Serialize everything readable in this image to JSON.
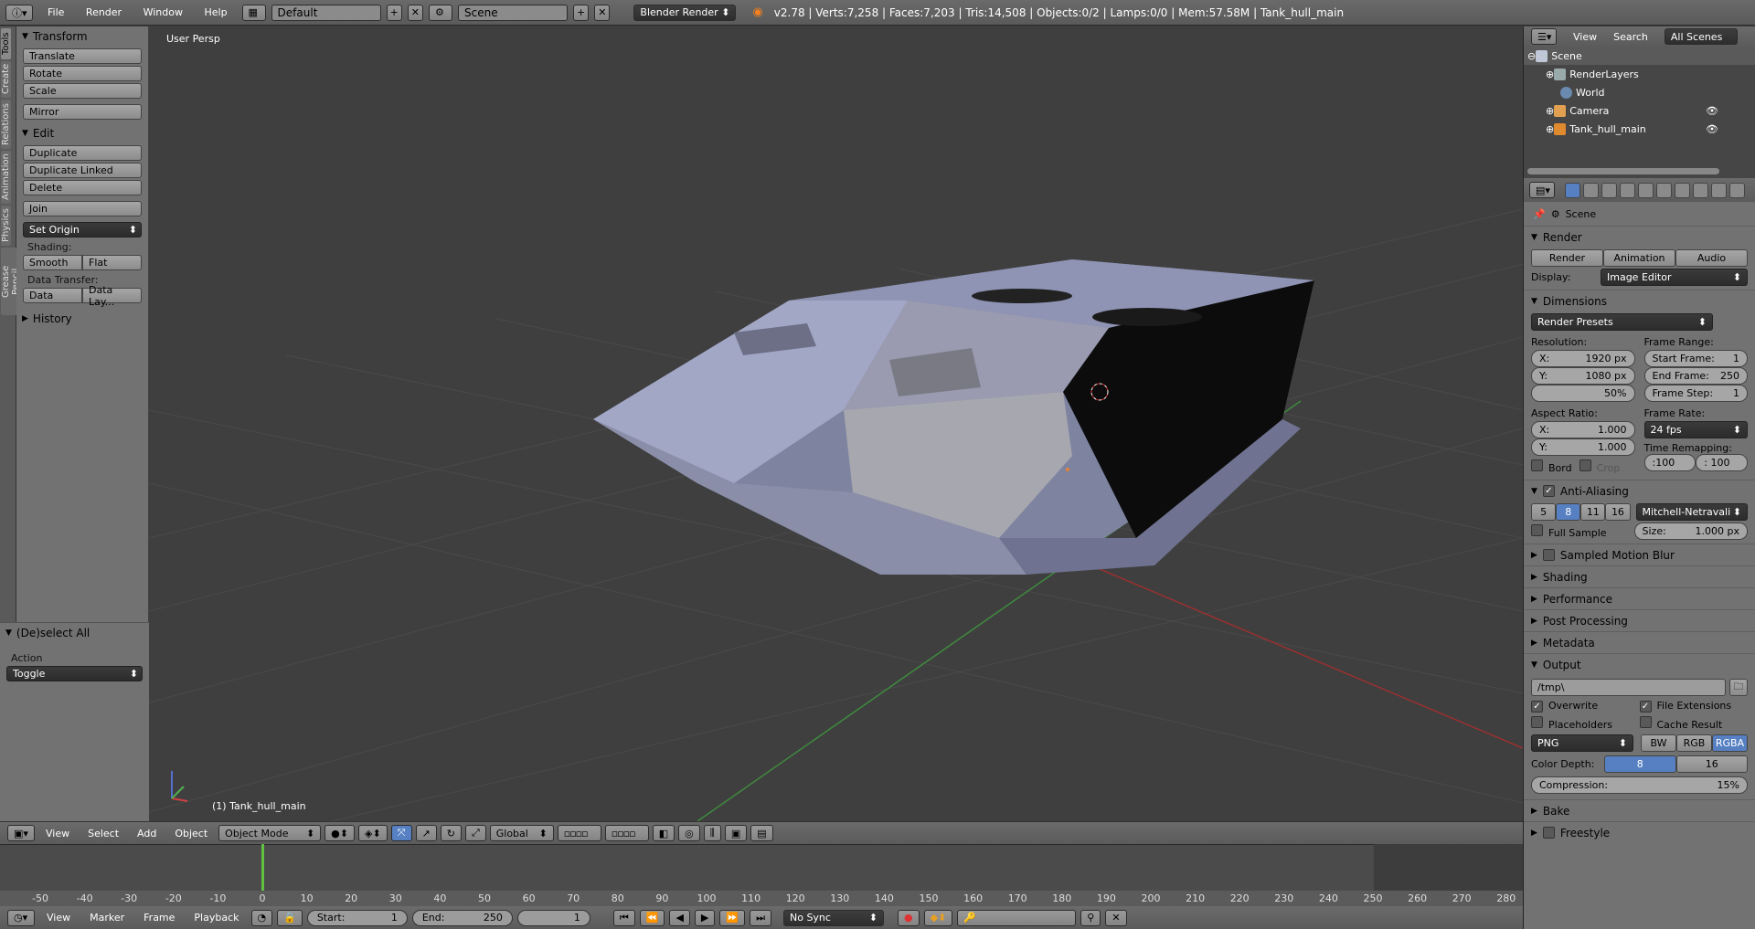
{
  "top_header": {
    "menus": [
      "File",
      "Render",
      "Window",
      "Help"
    ],
    "layout": "Default",
    "scene": "Scene",
    "engine": "Blender Render",
    "stats": "v2.78 | Verts:7,258 | Faces:7,203 | Tris:14,508 | Objects:0/2 | Lamps:0/0 | Mem:57.58M | Tank_hull_main"
  },
  "left_tabs": [
    "Tools",
    "Create",
    "Relations",
    "Animation",
    "Physics",
    "Grease Pencil"
  ],
  "tool_shelf": {
    "transform_title": "Transform",
    "translate": "Translate",
    "rotate": "Rotate",
    "scale": "Scale",
    "mirror": "Mirror",
    "edit_title": "Edit",
    "duplicate": "Duplicate",
    "duplicate_linked": "Duplicate Linked",
    "delete": "Delete",
    "join": "Join",
    "set_origin": "Set Origin",
    "shading_label": "Shading:",
    "smooth": "Smooth",
    "flat": "Flat",
    "data_transfer_label": "Data Transfer:",
    "data": "Data",
    "data_layers": "Data Lay...",
    "history_title": "History",
    "operator_title": "(De)select All",
    "action_label": "Action",
    "action_value": "Toggle"
  },
  "viewport": {
    "view_label": "User Persp",
    "object_label": "(1) Tank_hull_main"
  },
  "viewport_header": {
    "menus": [
      "View",
      "Select",
      "Add",
      "Object"
    ],
    "mode": "Object Mode",
    "orientation": "Global"
  },
  "timeline": {
    "ticks": [
      "-50",
      "-40",
      "-30",
      "-20",
      "-10",
      "0",
      "10",
      "20",
      "30",
      "40",
      "50",
      "60",
      "70",
      "80",
      "90",
      "100",
      "110",
      "120",
      "130",
      "140",
      "150",
      "160",
      "170",
      "180",
      "190",
      "200",
      "210",
      "220",
      "230",
      "240",
      "250",
      "260",
      "270",
      "280"
    ],
    "menus": [
      "View",
      "Marker",
      "Frame",
      "Playback"
    ],
    "start_label": "Start:",
    "start_value": "1",
    "end_label": "End:",
    "end_value": "250",
    "current": "1",
    "sync": "No Sync"
  },
  "outliner": {
    "menus": [
      "View",
      "Search"
    ],
    "filter": "All Scenes",
    "items": [
      "Scene",
      "RenderLayers",
      "World",
      "Camera",
      "Tank_hull_main"
    ]
  },
  "properties": {
    "context": "Scene",
    "render_title": "Render",
    "render_btn": "Render",
    "animation_btn": "Animation",
    "audio_btn": "Audio",
    "display_label": "Display:",
    "display_value": "Image Editor",
    "dimensions_title": "Dimensions",
    "render_presets": "Render Presets",
    "resolution_label": "Resolution:",
    "res_x": "X:",
    "res_x_val": "1920 px",
    "res_y": "Y:",
    "res_y_val": "1080 px",
    "res_pct": "50%",
    "frame_range_label": "Frame Range:",
    "start_frame": "Start Frame:",
    "start_frame_val": "1",
    "end_frame": "End Frame:",
    "end_frame_val": "250",
    "frame_step": "Frame Step:",
    "frame_step_val": "1",
    "aspect_label": "Aspect Ratio:",
    "asp_x_val": "1.000",
    "asp_y_val": "1.000",
    "frame_rate_label": "Frame Rate:",
    "frame_rate": "24 fps",
    "time_remap_label": "Time Remapping:",
    "remap_old": ":100",
    "remap_new": ": 100",
    "bord": "Bord",
    "crop": "Crop",
    "aa_title": "Anti-Aliasing",
    "aa_samples": [
      "5",
      "8",
      "11",
      "16"
    ],
    "aa_filter": "Mitchell-Netravali",
    "full_sample": "Full Sample",
    "size_label": "Size:",
    "size_val": "1.000 px",
    "motion_blur": "Sampled Motion Blur",
    "shading": "Shading",
    "performance": "Performance",
    "post_processing": "Post Processing",
    "metadata": "Metadata",
    "output_title": "Output",
    "output_path": "/tmp\\",
    "overwrite": "Overwrite",
    "file_ext": "File Extensions",
    "placeholders": "Placeholders",
    "cache_result": "Cache Result",
    "format": "PNG",
    "bw": "BW",
    "rgb": "RGB",
    "rgba": "RGBA",
    "color_depth_label": "Color Depth:",
    "depth_8": "8",
    "depth_16": "16",
    "compression_label": "Compression:",
    "compression_val": "15%",
    "bake": "Bake",
    "freestyle": "Freestyle"
  },
  "colors": {
    "accent": "#5680c2",
    "playhead": "#60c040",
    "x_axis": "#b03030",
    "y_axis": "#40a040"
  }
}
